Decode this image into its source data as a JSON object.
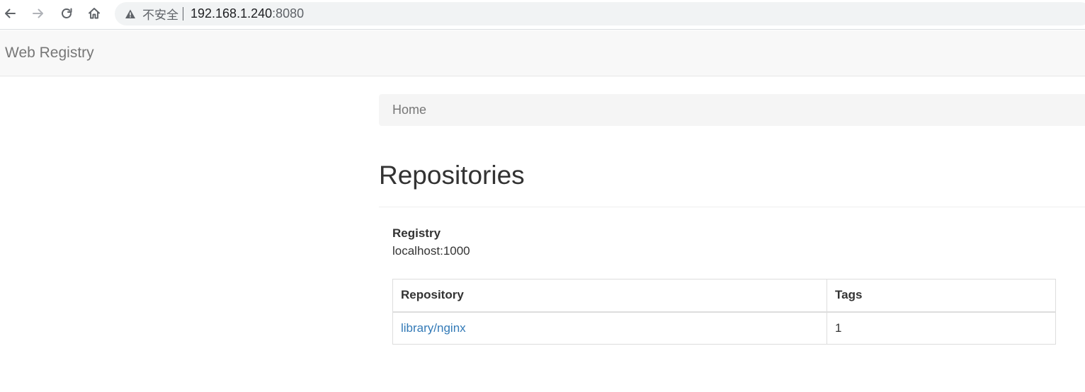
{
  "browser": {
    "security_label": "不安全",
    "url_host": "192.168.1.240",
    "url_port": ":8080"
  },
  "navbar": {
    "brand": "Web Registry"
  },
  "breadcrumb": {
    "items": [
      "Home"
    ]
  },
  "page": {
    "title": "Repositories",
    "registry_label": "Registry",
    "registry_value": "localhost:1000"
  },
  "table": {
    "columns": [
      "Repository",
      "Tags"
    ],
    "rows": [
      {
        "repository": "library/nginx",
        "tags": "1"
      }
    ]
  },
  "colors": {
    "link": "#337ab7",
    "navbar_bg": "#f8f8f8",
    "breadcrumb_bg": "#f5f5f5"
  },
  "icons": {
    "back": "arrow-left-icon",
    "forward": "arrow-right-icon",
    "reload": "reload-icon",
    "home": "home-icon",
    "security": "warning-triangle-icon"
  }
}
